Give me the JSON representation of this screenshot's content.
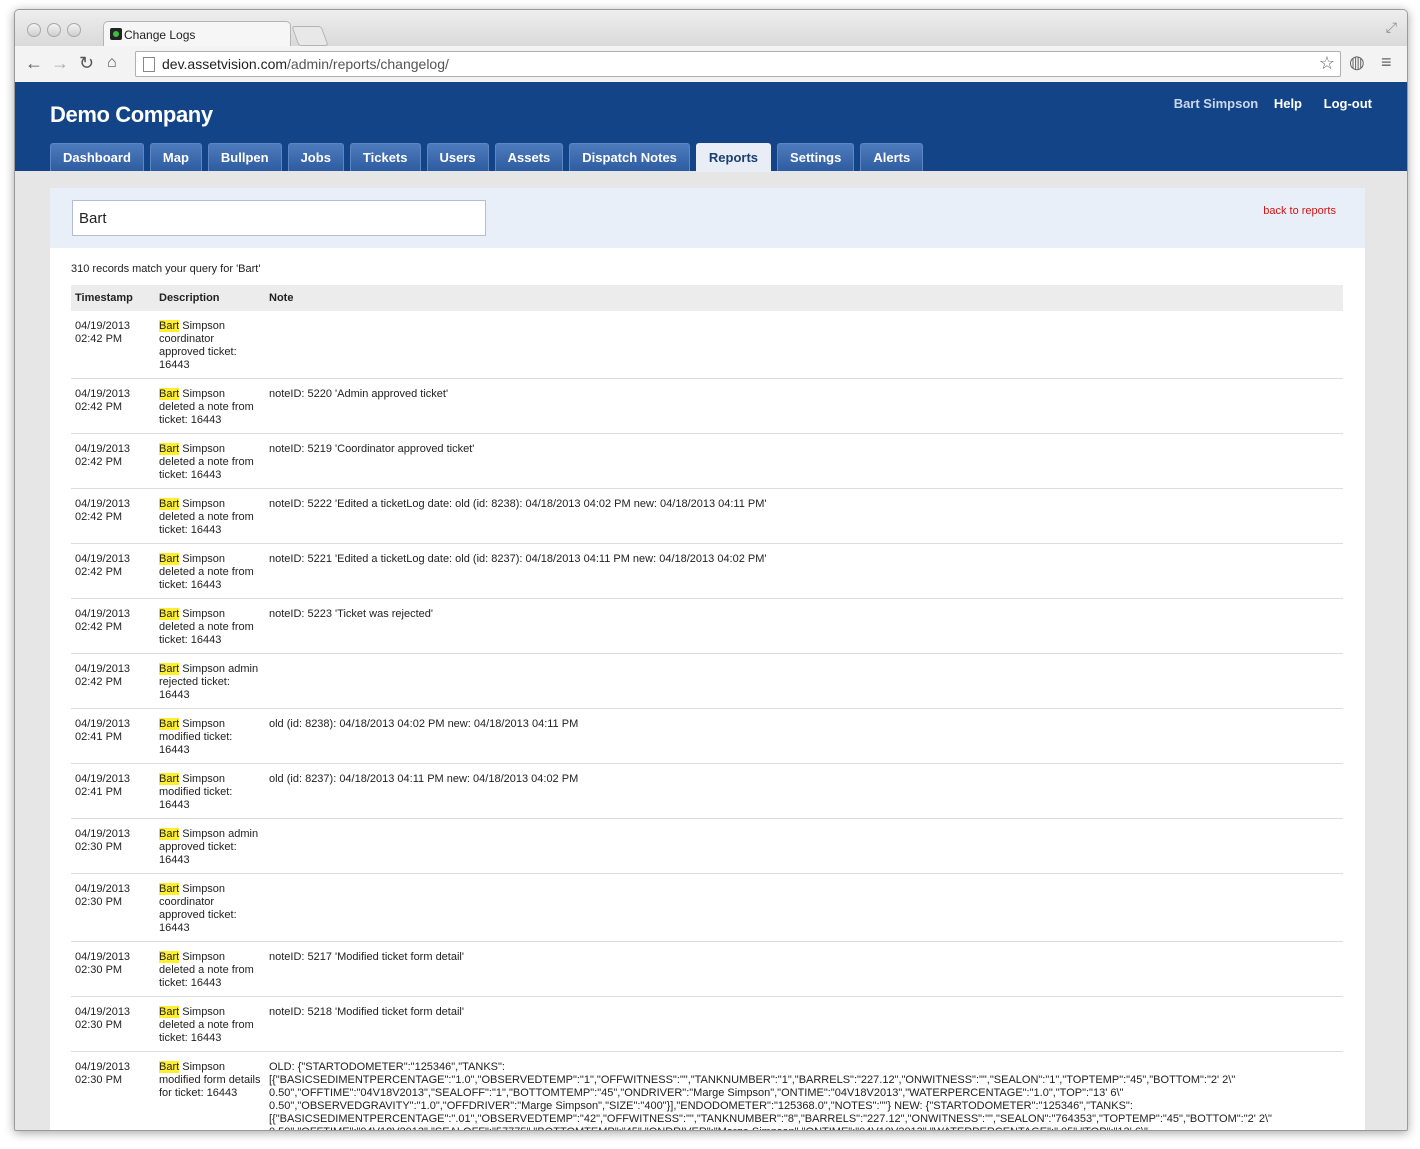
{
  "browser": {
    "tab_title": "Change Logs",
    "url_domain": "dev.assetvision.com",
    "url_path": "/admin/reports/changelog/"
  },
  "header": {
    "company": "Demo Company",
    "user": "Bart Simpson",
    "help": "Help",
    "logout": "Log-out"
  },
  "nav": [
    {
      "label": "Dashboard",
      "active": false
    },
    {
      "label": "Map",
      "active": false
    },
    {
      "label": "Bullpen",
      "active": false
    },
    {
      "label": "Jobs",
      "active": false
    },
    {
      "label": "Tickets",
      "active": false
    },
    {
      "label": "Users",
      "active": false
    },
    {
      "label": "Assets",
      "active": false
    },
    {
      "label": "Dispatch Notes",
      "active": false
    },
    {
      "label": "Reports",
      "active": true
    },
    {
      "label": "Settings",
      "active": false
    },
    {
      "label": "Alerts",
      "active": false
    }
  ],
  "search": {
    "value": "Bart",
    "back_link": "back to reports",
    "count_text": "310 records match your query for 'Bart'"
  },
  "table": {
    "headers": [
      "Timestamp",
      "Description",
      "Note"
    ],
    "highlight": "Bart",
    "rows": [
      {
        "date": "04/19/2013",
        "time": "02:42 PM",
        "desc_rest": " Simpson coordinator approved ticket: 16443",
        "note": ""
      },
      {
        "date": "04/19/2013",
        "time": "02:42 PM",
        "desc_rest": " Simpson deleted a note from ticket: 16443",
        "note": "noteID: 5220 'Admin approved ticket'"
      },
      {
        "date": "04/19/2013",
        "time": "02:42 PM",
        "desc_rest": " Simpson deleted a note from ticket: 16443",
        "note": "noteID: 5219 'Coordinator approved ticket'"
      },
      {
        "date": "04/19/2013",
        "time": "02:42 PM",
        "desc_rest": " Simpson deleted a note from ticket: 16443",
        "note": "noteID: 5222 'Edited a ticketLog date: old (id: 8238): 04/18/2013 04:02 PM new: 04/18/2013 04:11 PM'"
      },
      {
        "date": "04/19/2013",
        "time": "02:42 PM",
        "desc_rest": " Simpson deleted a note from ticket: 16443",
        "note": "noteID: 5221 'Edited a ticketLog date: old (id: 8237): 04/18/2013 04:11 PM new: 04/18/2013 04:02 PM'"
      },
      {
        "date": "04/19/2013",
        "time": "02:42 PM",
        "desc_rest": " Simpson deleted a note from ticket: 16443",
        "note": "noteID: 5223 'Ticket was rejected'"
      },
      {
        "date": "04/19/2013",
        "time": "02:42 PM",
        "desc_rest": " Simpson admin rejected ticket: 16443",
        "note": ""
      },
      {
        "date": "04/19/2013",
        "time": "02:41 PM",
        "desc_rest": " Simpson modified ticket: 16443",
        "note": "old (id: 8238): 04/18/2013 04:02 PM new: 04/18/2013 04:11 PM"
      },
      {
        "date": "04/19/2013",
        "time": "02:41 PM",
        "desc_rest": " Simpson modified ticket: 16443",
        "note": "old (id: 8237): 04/18/2013 04:11 PM new: 04/18/2013 04:02 PM"
      },
      {
        "date": "04/19/2013",
        "time": "02:30 PM",
        "desc_rest": " Simpson admin approved ticket: 16443",
        "note": ""
      },
      {
        "date": "04/19/2013",
        "time": "02:30 PM",
        "desc_rest": " Simpson coordinator approved ticket: 16443",
        "note": ""
      },
      {
        "date": "04/19/2013",
        "time": "02:30 PM",
        "desc_rest": " Simpson deleted a note from ticket: 16443",
        "note": "noteID: 5217 'Modified ticket form detail'"
      },
      {
        "date": "04/19/2013",
        "time": "02:30 PM",
        "desc_rest": " Simpson deleted a note from ticket: 16443",
        "note": "noteID: 5218 'Modified ticket form detail'"
      },
      {
        "date": "04/19/2013",
        "time": "02:30 PM",
        "desc_rest": " Simpson modified form details for ticket: 16443",
        "note": "OLD: {\"STARTODOMETER\":\"125346\",\"TANKS\":[{\"BASICSEDIMENTPERCENTAGE\":\"1.0\",\"OBSERVEDTEMP\":\"1\",\"OFFWITNESS\":\"\",\"TANKNUMBER\":\"1\",\"BARRELS\":\"227.12\",\"ONWITNESS\":\"\",\"SEALON\":\"1\",\"TOPTEMP\":\"45\",\"BOTTOM\":\"2' 2\\\" 0.50\",\"OFFTIME\":\"04V18V2013\",\"SEALOFF\":\"1\",\"BOTTOMTEMP\":\"45\",\"ONDRIVER\":\"Marge Simpson\",\"ONTIME\":\"04V18V2013\",\"WATERPERCENTAGE\":\"1.0\",\"TOP\":\"13' 6\\\" 0.50\",\"OBSERVEDGRAVITY\":\"1.0\",\"OFFDRIVER\":\"Marge Simpson\",\"SIZE\":\"400\"}],\"ENDODOMETER\":\"125368.0\",\"NOTES\":\"\"} NEW: {\"STARTODOMETER\":\"125346\",\"TANKS\":[{\"BASICSEDIMENTPERCENTAGE\":\".01\",\"OBSERVEDTEMP\":\"42\",\"OFFWITNESS\":\"\",\"TANKNUMBER\":\"8\",\"BARRELS\":\"227.12\",\"ONWITNESS\":\"\",\"SEALON\":\"764353\",\"TOPTEMP\":\"45\",\"BOTTOM\":\"2' 2\\\" 0.50\",\"OFFTIME\":\"04V18V2013\",\"SEALOFF\":\"57775\",\"BOTTOMTEMP\":\"45\",\"ONDRIVER\":\"Marge Simpson\",\"ONTIME\":\"04V18V2013\",\"WATERPERCENTAGE\":\".05\",\"TOP\":\"13' 6\\\" 0.50\",\"OBSERVEDGRAVITY\":\"41\",\"OFFDRIVER\":\"Marge Simpson\",\"SIZE\":\"400\"}],\"ENDODOMETER\":\"125368.0\",\"NOTES\":\"The access road to the well is very muddy.\"}"
      }
    ]
  }
}
